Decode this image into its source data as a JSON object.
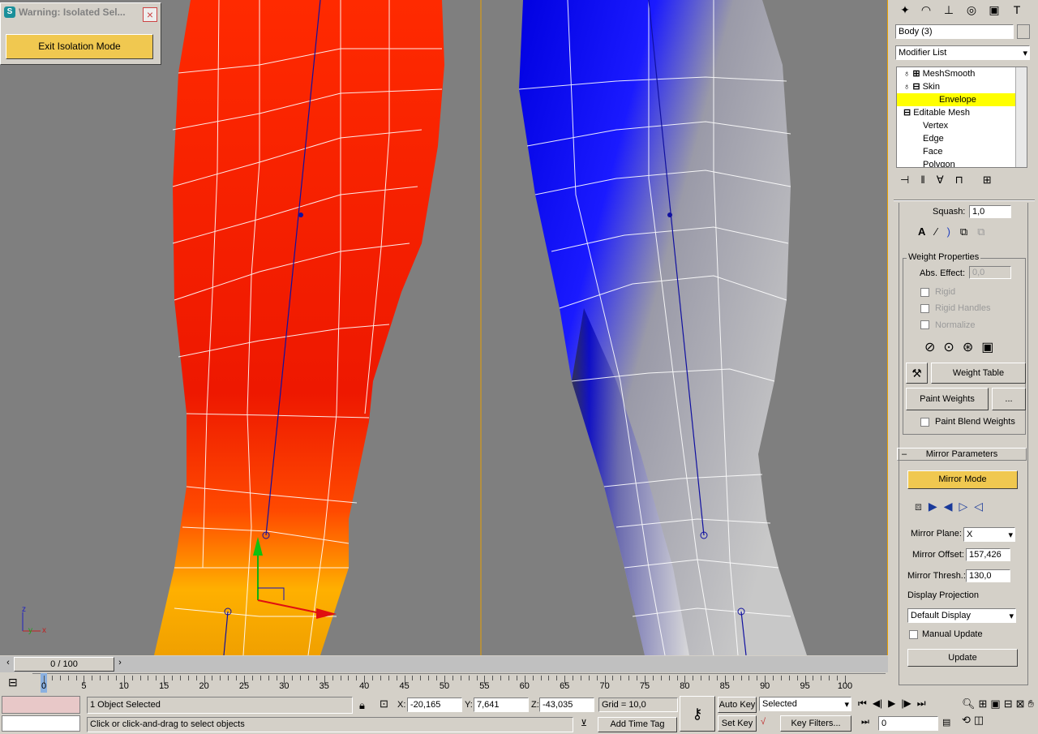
{
  "warning": {
    "title": "Warning: Isolated Sel...",
    "exit_label": "Exit Isolation Mode"
  },
  "viewport": {
    "axis_x": "x",
    "axis_y": "y",
    "axis_z": "z"
  },
  "command_panel": {
    "object_name": "Body (3)",
    "modifier_list": "Modifier List",
    "stack": [
      {
        "label": "MeshSmooth"
      },
      {
        "label": "Skin"
      },
      {
        "label": "Envelope"
      },
      {
        "label": "Editable Mesh"
      },
      {
        "label": "Vertex"
      },
      {
        "label": "Edge"
      },
      {
        "label": "Face"
      },
      {
        "label": "Polygon"
      }
    ],
    "squash_label": "Squash:",
    "squash_value": "1,0",
    "weight_props": {
      "title": "Weight Properties",
      "abs_effect_label": "Abs. Effect:",
      "abs_effect_value": "0,0",
      "rigid": "Rigid",
      "rigid_handles": "Rigid Handles",
      "normalize": "Normalize",
      "weight_table": "Weight Table",
      "paint_weights": "Paint Weights",
      "dots": "...",
      "paint_blend": "Paint Blend Weights"
    },
    "mirror": {
      "toggle": "–",
      "title": "Mirror Parameters",
      "mode": "Mirror Mode",
      "plane_label": "Mirror Plane:",
      "plane_value": "X",
      "offset_label": "Mirror Offset:",
      "offset_value": "157,426",
      "thresh_label": "Mirror Thresh.:",
      "thresh_value": "130,0",
      "projection_label": "Display Projection",
      "projection_value": "Default Display",
      "manual_update": "Manual Update",
      "update": "Update"
    }
  },
  "timeline": {
    "frame_label": "0 / 100",
    "ticks": [
      "0",
      "5",
      "10",
      "15",
      "20",
      "25",
      "30",
      "35",
      "40",
      "45",
      "50",
      "55",
      "60",
      "65",
      "70",
      "75",
      "80",
      "85",
      "90",
      "95",
      "100"
    ]
  },
  "status": {
    "selected": "1 Object Selected",
    "prompt": "Click or click-and-drag to select objects",
    "x_label": "X:",
    "x_value": "-20,165",
    "y_label": "Y:",
    "y_value": "7,641",
    "z_label": "Z:",
    "z_value": "-43,035",
    "grid": "Grid = 10,0",
    "add_time_tag": "Add Time Tag",
    "auto_key": "Auto Key",
    "set_key": "Set Key",
    "selected_dropdown": "Selected",
    "key_filters": "Key Filters...",
    "frame_value": "0"
  }
}
